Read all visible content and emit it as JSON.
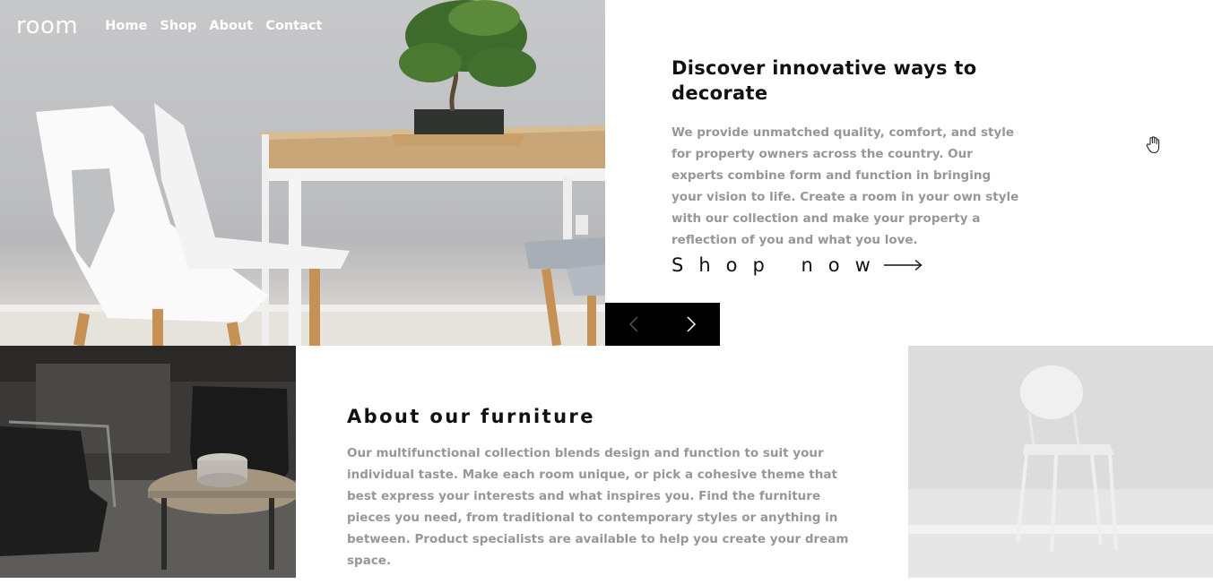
{
  "nav": {
    "logo": "room",
    "links": [
      "Home",
      "Shop",
      "About",
      "Contact"
    ]
  },
  "hero": {
    "title": "Discover innovative ways to decorate",
    "body": "We provide unmatched quality, comfort, and style for property owners across the country. Our experts combine form and function in bringing your vision to life. Create a room in your own style with our collection and make your property a reflection of you and what you love.",
    "cta_label": "Shop now",
    "image": "dining-table-chairs-bonsai-photo"
  },
  "slider": {
    "prev_icon": "chevron-left-icon",
    "next_icon": "chevron-right-icon"
  },
  "about": {
    "title": "About our furniture",
    "body": "Our multifunctional collection blends design and function to suit your individual taste. Make each room unique, or pick a cohesive theme that best express your interests and what inspires you. Find the furniture pieces you need, from traditional to contemporary styles or anything in between. Product specialists are available to help you create your dream space.",
    "image_left": "dark-living-room-armchairs-photo",
    "image_right": "white-chair-photo"
  },
  "colors": {
    "text_dark": "#111111",
    "text_muted": "#979797",
    "slider_bg": "#000000"
  }
}
